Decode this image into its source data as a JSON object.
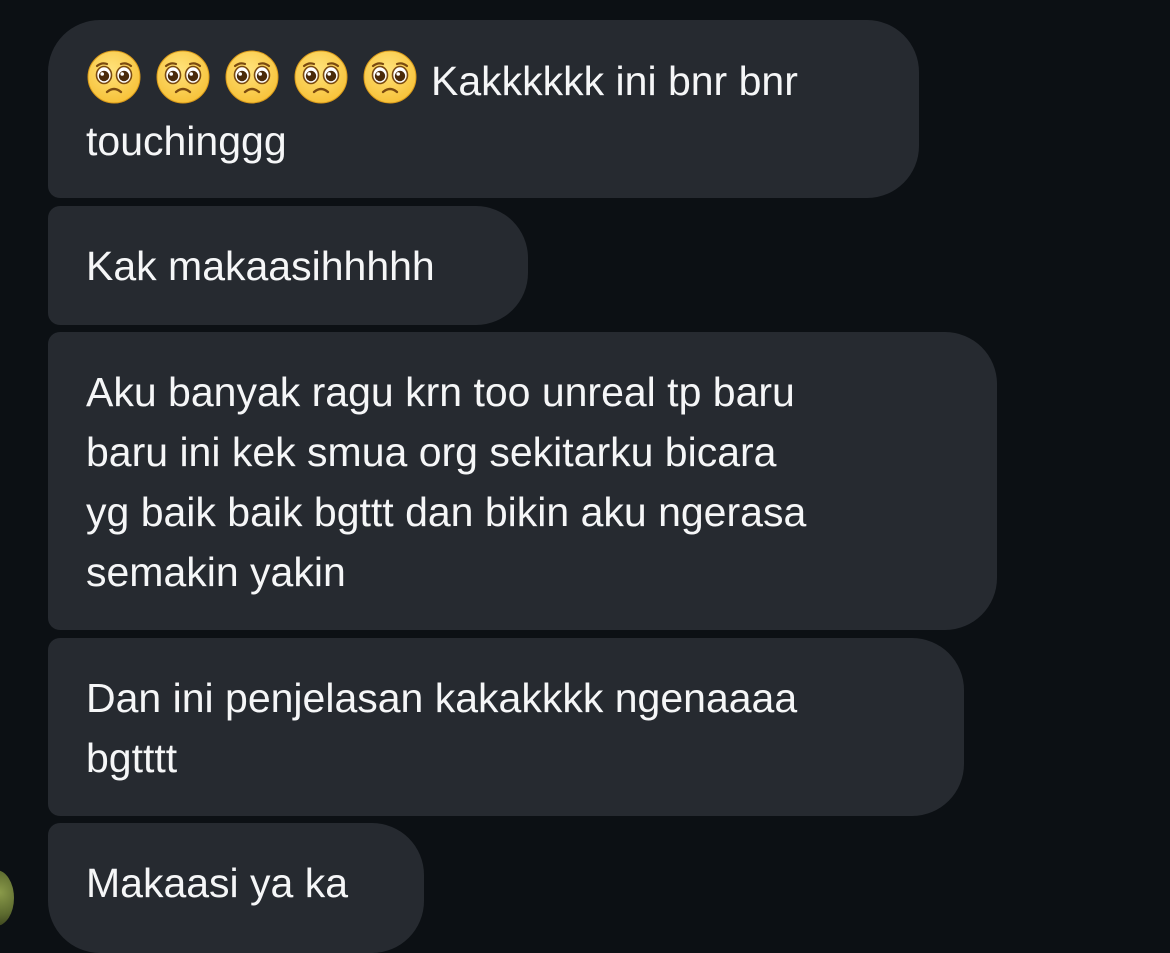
{
  "messages": [
    {
      "emojis": [
        "pleading-face-icon",
        "pleading-face-icon",
        "pleading-face-icon",
        "pleading-face-icon",
        "pleading-face-icon"
      ],
      "text_line1": "Kakkkkkk ini bnr bnr",
      "text_line2": "touchinggg"
    },
    {
      "text": "Kak makaasihhhhh"
    },
    {
      "lines": [
        "Aku banyak ragu krn too unreal tp baru",
        "baru ini kek smua org sekitarku bicara",
        "yg baik baik bgttt dan bikin aku ngerasa",
        "semakin yakin"
      ]
    },
    {
      "lines": [
        "Dan ini penjelasan kakakkkk ngenaaaa",
        "bgtttt"
      ]
    },
    {
      "text": "Makaasi ya ka"
    }
  ],
  "colors": {
    "background": "#0c1014",
    "bubble": "#262a30",
    "text": "#f5f6f7",
    "emoji_face": "#f7c23a"
  }
}
